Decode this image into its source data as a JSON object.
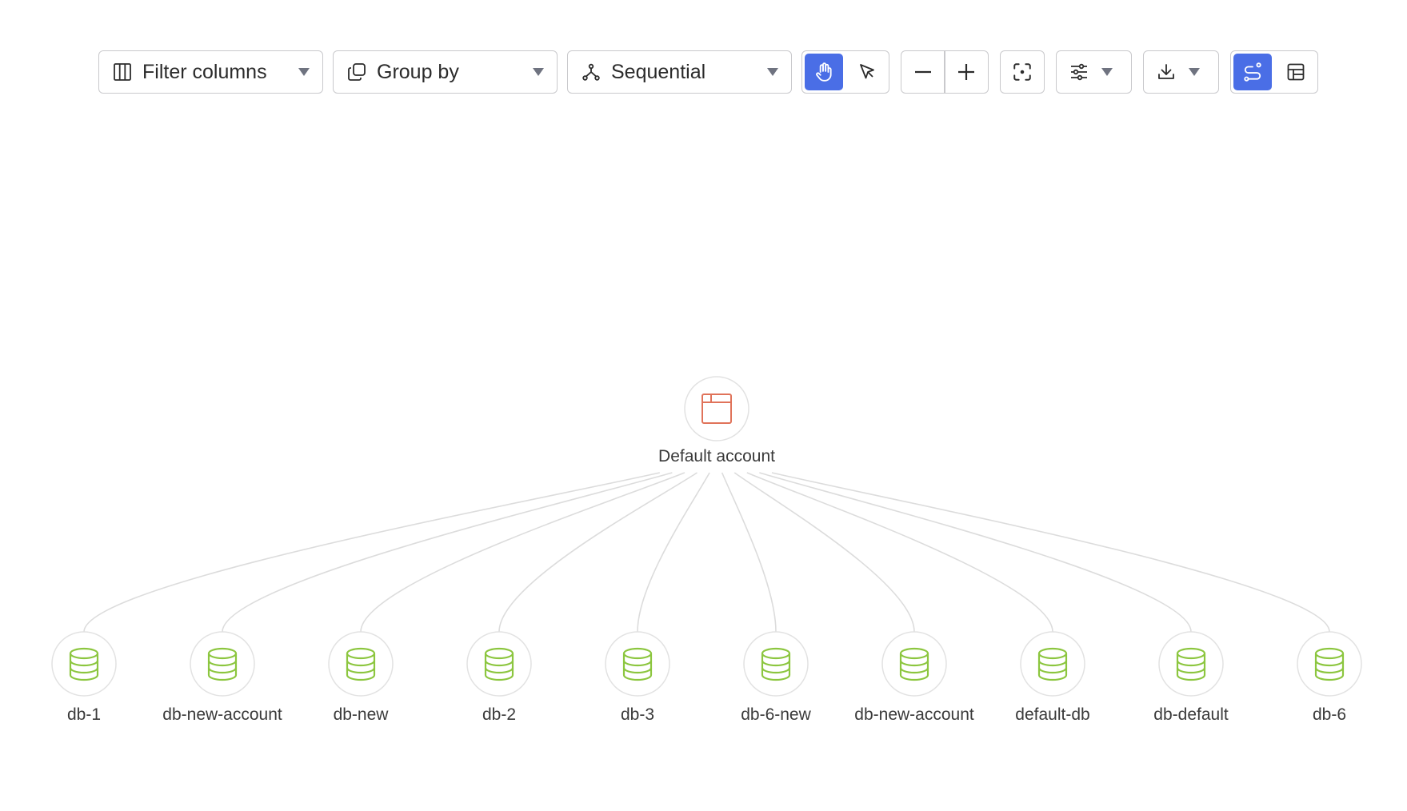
{
  "toolbar": {
    "filter_columns": {
      "label": "Filter columns"
    },
    "group_by": {
      "label": "Group by"
    },
    "layout": {
      "label": "Sequential"
    },
    "interaction_mode": {
      "active": "hand"
    },
    "view_mode": {
      "active": "graph"
    }
  },
  "colors": {
    "accent": "#4a6ee6",
    "root_icon": "#e0735a",
    "db_icon": "#8cc63f",
    "edge": "#dcdcdc",
    "node_border": "#e2e2e2"
  },
  "graph": {
    "root": {
      "label": "Default account",
      "icon": "window-icon"
    },
    "children": [
      {
        "label": "db-1",
        "icon": "database-icon"
      },
      {
        "label": "db-new-account",
        "icon": "database-icon"
      },
      {
        "label": "db-new",
        "icon": "database-icon"
      },
      {
        "label": "db-2",
        "icon": "database-icon"
      },
      {
        "label": "db-3",
        "icon": "database-icon"
      },
      {
        "label": "db-6-new",
        "icon": "database-icon"
      },
      {
        "label": "db-new-account",
        "icon": "database-icon"
      },
      {
        "label": "default-db",
        "icon": "database-icon"
      },
      {
        "label": "db-default",
        "icon": "database-icon"
      },
      {
        "label": "db-6",
        "icon": "database-icon"
      }
    ]
  }
}
